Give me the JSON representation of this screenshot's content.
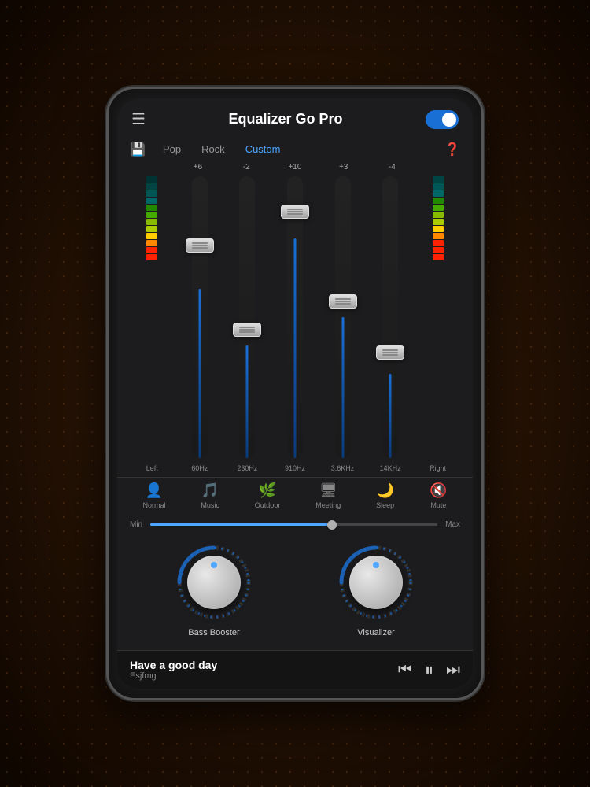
{
  "app": {
    "title": "Equalizer Go Pro",
    "toggle_on": true
  },
  "presets": {
    "save_label": "💾",
    "items": [
      {
        "label": "Pop",
        "active": false
      },
      {
        "label": "Rock",
        "active": false
      },
      {
        "label": "Custom",
        "active": true
      }
    ],
    "help_label": "?"
  },
  "eq": {
    "channels": [
      {
        "id": "left",
        "label": "Left",
        "value": "",
        "handle_top_pct": 40,
        "line_top_pct": 55,
        "line_height_pct": 45,
        "is_vu": true
      },
      {
        "id": "60hz",
        "label": "60Hz",
        "value": "+6",
        "handle_top_pct": 25,
        "line_top_pct": 40,
        "line_height_pct": 60
      },
      {
        "id": "230hz",
        "label": "230Hz",
        "value": "-2",
        "handle_top_pct": 55,
        "line_top_pct": 65,
        "line_height_pct": 35
      },
      {
        "id": "910hz",
        "label": "910Hz",
        "value": "+10",
        "handle_top_pct": 15,
        "line_top_pct": 28,
        "line_height_pct": 72
      },
      {
        "id": "3k6hz",
        "label": "3.6KHz",
        "value": "+3",
        "handle_top_pct": 45,
        "line_top_pct": 57,
        "line_height_pct": 43
      },
      {
        "id": "14khz",
        "label": "14KHz",
        "value": "-4",
        "handle_top_pct": 62,
        "line_top_pct": 72,
        "line_height_pct": 28
      },
      {
        "id": "right",
        "label": "Right",
        "value": "",
        "handle_top_pct": 0,
        "line_top_pct": 0,
        "line_height_pct": 0,
        "is_vu": true
      }
    ]
  },
  "sound_modes": [
    {
      "label": "Normal",
      "icon": "👤"
    },
    {
      "label": "Music",
      "icon": "🎵"
    },
    {
      "label": "Outdoor",
      "icon": "🌿"
    },
    {
      "label": "Meeting",
      "icon": "🖥"
    },
    {
      "label": "Sleep",
      "icon": "🌙"
    },
    {
      "label": "Mute",
      "icon": "🔇"
    }
  ],
  "volume": {
    "min_label": "Min",
    "max_label": "Max",
    "value_pct": 65
  },
  "knobs": [
    {
      "label": "Bass Booster"
    },
    {
      "label": "Visualizer"
    }
  ],
  "player": {
    "title": "Have a good day",
    "artist": "Esjfmg",
    "prev_label": "⏮",
    "play_label": "⏸",
    "next_label": "⏭"
  }
}
